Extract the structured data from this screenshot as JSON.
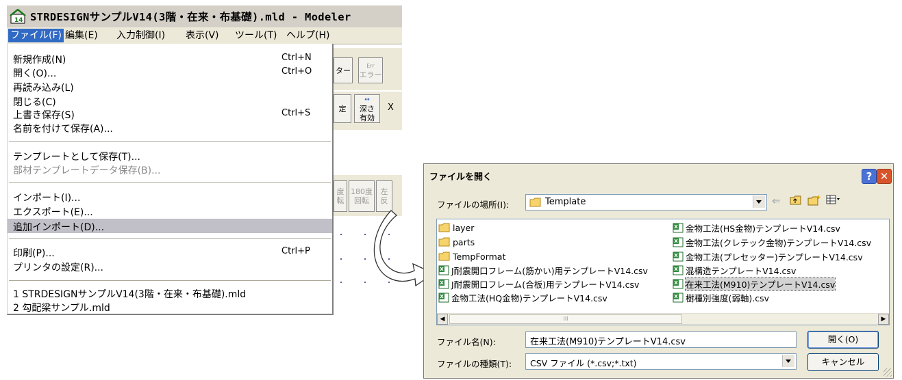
{
  "modeler": {
    "title": "STRDESIGNサンプルV14(3階・在来・布基礎).mld - Modeler",
    "menubar": [
      "ファイル(F)",
      "編集(E)",
      "入力制御(I)",
      "表示(V)",
      "ツール(T)",
      "ヘルプ(H)"
    ],
    "toolbar": {
      "b1": "ター",
      "b2_top": "Err",
      "b2": "エラー",
      "b3a": "深さ",
      "b3b": "有効",
      "b4": "定",
      "x": "X",
      "r1": "度転",
      "r2a": "180度",
      "r2b": "回転",
      "r3a": "左",
      "r3b": "反"
    },
    "file_menu": [
      {
        "label": "新規作成(N)",
        "shortcut": "Ctrl+N"
      },
      {
        "label": "開く(O)...",
        "shortcut": "Ctrl+O"
      },
      {
        "label": "再読み込み(L)",
        "shortcut": ""
      },
      {
        "label": "閉じる(C)",
        "shortcut": ""
      },
      {
        "label": "上書き保存(S)",
        "shortcut": "Ctrl+S"
      },
      {
        "label": "名前を付けて保存(A)...",
        "shortcut": ""
      },
      {
        "label": "テンプレートとして保存(T)...",
        "shortcut": ""
      },
      {
        "label": "部材テンプレートデータ保存(B)...",
        "shortcut": ""
      },
      {
        "label": "インポート(I)...",
        "shortcut": ""
      },
      {
        "label": "エクスポート(E)...",
        "shortcut": ""
      },
      {
        "label": "追加インポート(D)...",
        "shortcut": ""
      },
      {
        "label": "印刷(P)...",
        "shortcut": "Ctrl+P"
      },
      {
        "label": "プリンタの設定(R)...",
        "shortcut": ""
      },
      {
        "label": "1 STRDESIGNサンプルV14(3階・在来・布基礎).mld",
        "shortcut": ""
      },
      {
        "label": "2 勾配梁サンプル.mld",
        "shortcut": ""
      }
    ]
  },
  "dialog": {
    "title": "ファイルを開く",
    "help": "?",
    "close": "✕",
    "look_in_label": "ファイルの場所(I):",
    "look_in_value": "Template",
    "files_left": [
      {
        "name": "layer",
        "type": "folder"
      },
      {
        "name": "parts",
        "type": "folder"
      },
      {
        "name": "TempFormat",
        "type": "folder"
      },
      {
        "name": "J耐震開口フレーム(筋かい)用テンプレートV14.csv",
        "type": "csv"
      },
      {
        "name": "J耐震開口フレーム(合板)用テンプレートV14.csv",
        "type": "csv"
      },
      {
        "name": "金物工法(HQ金物)テンプレートV14.csv",
        "type": "csv"
      }
    ],
    "files_right": [
      {
        "name": "金物工法(HS金物)テンプレートV14.csv",
        "type": "csv"
      },
      {
        "name": "金物工法(クレテック金物)テンプレートV14.csv",
        "type": "csv"
      },
      {
        "name": "金物工法(プレセッター)テンプレートV14.csv",
        "type": "csv"
      },
      {
        "name": "混構造テンプレートV14.csv",
        "type": "csv"
      },
      {
        "name": "在来工法(M910)テンプレートV14.csv",
        "type": "csv"
      },
      {
        "name": "樹種別強度(弱軸).csv",
        "type": "csv"
      }
    ],
    "file_name_label": "ファイル名(N):",
    "file_name_value": "在来工法(M910)テンプレートV14.csv",
    "file_type_label": "ファイルの種類(T):",
    "file_type_value": "CSV ファイル (*.csv;*.txt)",
    "open_button": "開く(O)",
    "cancel_button": "キャンセル",
    "scroll_thumb": "III"
  }
}
